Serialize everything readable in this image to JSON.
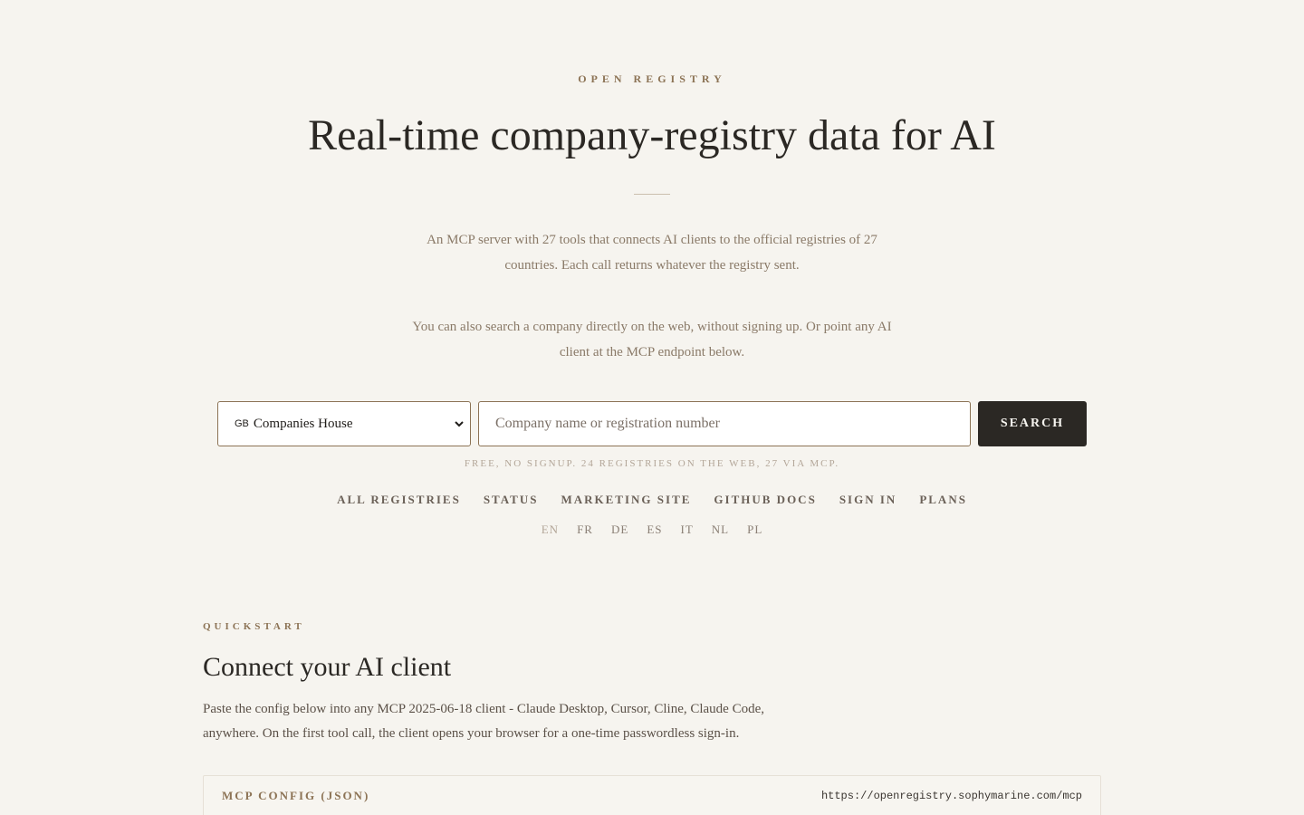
{
  "hero": {
    "eyebrow": "OPEN REGISTRY",
    "title": "Real-time company-registry data for AI",
    "lede_1": "An MCP server with 27 tools that connects AI clients to the official registries of 27 countries. Each call returns whatever the registry sent.",
    "lede_2": "You can also search a company directly on the web, without signing up. Or point any AI client at the MCP endpoint below."
  },
  "search": {
    "registry_flag": "GB",
    "registry_selected": "Companies House",
    "input_value": "",
    "placeholder": "Company name or registration number",
    "button_label": "SEARCH",
    "note": "FREE, NO SIGNUP. 24 REGISTRIES ON THE WEB, 27 VIA MCP."
  },
  "nav": {
    "links": [
      "ALL REGISTRIES",
      "STATUS",
      "MARKETING SITE",
      "GITHUB DOCS",
      "SIGN IN",
      "PLANS"
    ]
  },
  "languages": {
    "items": [
      "EN",
      "FR",
      "DE",
      "ES",
      "IT",
      "NL",
      "PL"
    ],
    "active": "EN"
  },
  "quickstart": {
    "eyebrow": "QUICKSTART",
    "title": "Connect your AI client",
    "body": "Paste the config below into any MCP 2025-06-18 client - Claude Desktop, Cursor, Cline, Claude Code, anywhere. On the first tool call, the client opens your browser for a one-time passwordless sign-in.",
    "config_label": "MCP CONFIG (JSON)",
    "config_url": "https://openregistry.sophymarine.com/mcp"
  },
  "colors": {
    "background": "#f6f4ef",
    "accent": "#8c7355",
    "button": "#2b2824"
  }
}
